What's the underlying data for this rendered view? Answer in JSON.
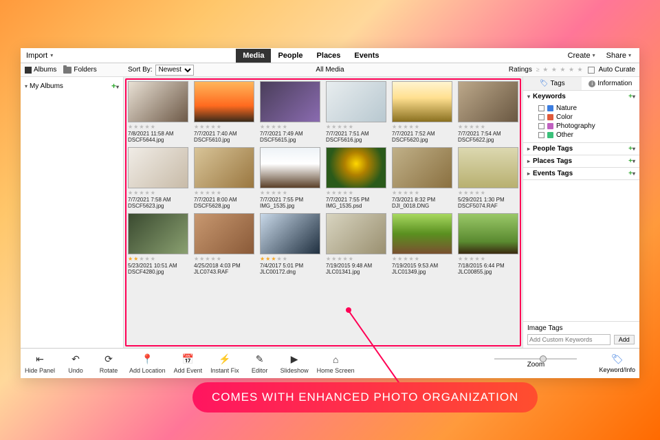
{
  "topbar": {
    "import": "Import",
    "tabs": [
      "Media",
      "People",
      "Places",
      "Events"
    ],
    "active_tab": 0,
    "create": "Create",
    "share": "Share"
  },
  "subbar": {
    "albums": "Albums",
    "folders": "Folders",
    "sort_label": "Sort By:",
    "sort_value": "Newest",
    "center": "All Media",
    "ratings_label": "Ratings",
    "auto_curate": "Auto Curate"
  },
  "left": {
    "header": "My Albums"
  },
  "right": {
    "tabs": {
      "tags": "Tags",
      "info": "Information"
    },
    "keywords": {
      "label": "Keywords",
      "items": [
        {
          "label": "Nature",
          "color": "#3b7de0"
        },
        {
          "label": "Color",
          "color": "#e05a3b"
        },
        {
          "label": "Photography",
          "color": "#c060c0"
        },
        {
          "label": "Other",
          "color": "#3bc07a"
        }
      ]
    },
    "people": "People Tags",
    "places": "Places Tags",
    "events": "Events Tags",
    "image_tags": {
      "label": "Image Tags",
      "placeholder": "Add Custom Keywords",
      "add": "Add"
    }
  },
  "thumbs": [
    {
      "ts": "7/8/2021 11:58 AM",
      "fn": "DSCF5644.jpg",
      "stars": 0,
      "bg": "linear-gradient(135deg,#e8e0d4,#6e5a48)"
    },
    {
      "ts": "7/7/2021 7:40 AM",
      "fn": "DSCF5610.jpg",
      "stars": 0,
      "bg": "linear-gradient(#ffb65a 0%,#ff6a1f 60%,#3a2a1a 100%)"
    },
    {
      "ts": "7/7/2021 7:49 AM",
      "fn": "DSCF5615.jpg",
      "stars": 0,
      "bg": "linear-gradient(135deg,#4a3e5a,#8a6bb0)"
    },
    {
      "ts": "7/7/2021 7:51 AM",
      "fn": "DSCF5616.jpg",
      "stars": 0,
      "bg": "linear-gradient(135deg,#e8edef,#b8c8d0)"
    },
    {
      "ts": "7/7/2021 7:52 AM",
      "fn": "DSCF5620.jpg",
      "stars": 0,
      "bg": "linear-gradient(#fff4d0 0%,#ffe090 40%,#8a7020 100%)"
    },
    {
      "ts": "7/7/2021 7:54 AM",
      "fn": "DSCF5622.jpg",
      "stars": 0,
      "bg": "linear-gradient(135deg,#bca88a,#6a5842)"
    },
    {
      "ts": "7/7/2021 7:58 AM",
      "fn": "DSCF5623.jpg",
      "stars": 0,
      "bg": "linear-gradient(135deg,#f0ece6,#c8bba8)"
    },
    {
      "ts": "7/7/2021 8:00 AM",
      "fn": "DSCF5628.jpg",
      "stars": 0,
      "bg": "linear-gradient(135deg,#d8c498,#9a7740)"
    },
    {
      "ts": "7/7/2021 7:55 PM",
      "fn": "IMG_1535.jpg",
      "stars": 0,
      "bg": "linear-gradient(#eef3f7 0%,#ffffff 40%,#5a4028 100%)"
    },
    {
      "ts": "7/7/2021 7:55 PM",
      "fn": "IMG_1535.psd",
      "stars": 0,
      "bg": "radial-gradient(circle at 50% 40%,#ffd700 0%,#b08000 30%,#2a5a1a 70%)"
    },
    {
      "ts": "7/3/2021 8:32 PM",
      "fn": "DJI_0018.DNG",
      "stars": 0,
      "bg": "linear-gradient(135deg,#c0b088,#8a7040)"
    },
    {
      "ts": "5/29/2021 1:30 PM",
      "fn": "DSCF5074.RAF",
      "stars": 0,
      "bg": "linear-gradient(#dcd8b0,#b8b070)"
    },
    {
      "ts": "5/23/2021 10:51 AM",
      "fn": "DSCF4280.jpg",
      "stars": 2,
      "bg": "linear-gradient(135deg,#3a4a30,#8aa070)"
    },
    {
      "ts": "4/25/2018 4:03 PM",
      "fn": "JLC0743.RAF",
      "stars": 0,
      "bg": "linear-gradient(135deg,#c89870,#8a5a38)"
    },
    {
      "ts": "7/4/2017 5:01 PM",
      "fn": "JLC00172.dng",
      "stars": 3,
      "bg": "linear-gradient(135deg,#c8d8e8,#203040)"
    },
    {
      "ts": "7/19/2015 9:48 AM",
      "fn": "JLC01341.jpg",
      "stars": 0,
      "bg": "linear-gradient(135deg,#d8d4c0,#9a9070)"
    },
    {
      "ts": "7/19/2015 9:53 AM",
      "fn": "JLC01349.jpg",
      "stars": 0,
      "bg": "linear-gradient(#a8d860 0%,#5a9020 50%,#7a5030 100%)"
    },
    {
      "ts": "7/18/2015 6:44 PM",
      "fn": "JLC00855.jpg",
      "stars": 0,
      "bg": "linear-gradient(#9ac868 0%,#5a8a30 70%,#3a2a10 100%)"
    }
  ],
  "tools": [
    {
      "name": "hide-panel",
      "label": "Hide Panel",
      "icon": "⇤"
    },
    {
      "name": "undo",
      "label": "Undo",
      "icon": "↶"
    },
    {
      "name": "rotate",
      "label": "Rotate",
      "icon": "⟳"
    },
    {
      "name": "add-location",
      "label": "Add Location",
      "icon": "📍"
    },
    {
      "name": "add-event",
      "label": "Add Event",
      "icon": "📅"
    },
    {
      "name": "instant-fix",
      "label": "Instant Fix",
      "icon": "⚡"
    },
    {
      "name": "editor",
      "label": "Editor",
      "icon": "✎"
    },
    {
      "name": "slideshow",
      "label": "Slideshow",
      "icon": "▶"
    },
    {
      "name": "home-screen",
      "label": "Home Screen",
      "icon": "⌂"
    }
  ],
  "zoom_label": "Zoom",
  "keyword_info": "Keyword/Info",
  "callout": "COMES WITH ENHANCED PHOTO ORGANIZATION"
}
